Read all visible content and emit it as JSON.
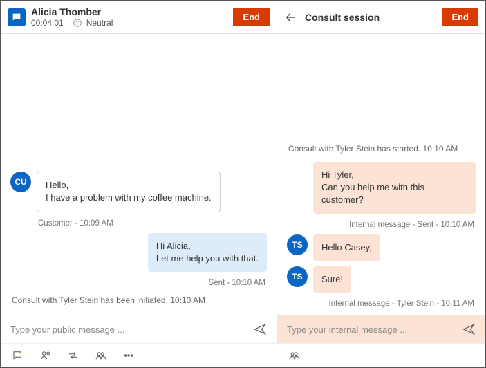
{
  "left": {
    "customer_name": "Alicia Thomber",
    "timer": "00:04:01",
    "sentiment": "Neutral",
    "end_label": "End",
    "messages": {
      "customer": {
        "avatar": "CU",
        "text": "Hello,\nI have a problem with my coffee machine.",
        "meta": "Customer - 10:09 AM"
      },
      "agent": {
        "text": "Hi Alicia,\nLet me help you with that.",
        "meta": "Sent - 10:10 AM"
      },
      "system": "Consult with Tyler Stein has been initiated. 10:10 AM"
    },
    "composer_placeholder": "Type your public message ..."
  },
  "right": {
    "title": "Consult session",
    "end_label": "End",
    "system_start": "Consult with Tyler Stein has started. 10:10 AM",
    "out1": {
      "text": "Hi Tyler,\nCan you help me with this customer?",
      "meta": "Internal message - Sent - 10:10 AM"
    },
    "in1": {
      "avatar": "TS",
      "text": "Hello Casey,"
    },
    "in2": {
      "avatar": "TS",
      "text": "Sure!"
    },
    "in_meta": "Internal message - Tyler Stein - 10:11 AM",
    "composer_placeholder": "Type your internal message ..."
  }
}
